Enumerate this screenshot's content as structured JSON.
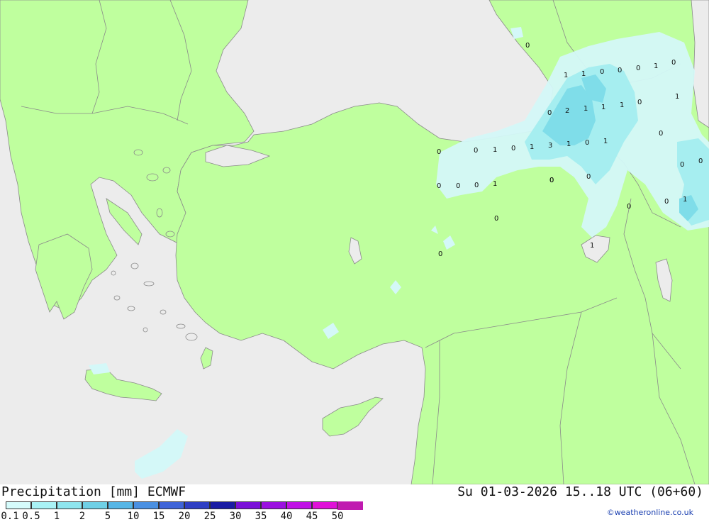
{
  "map": {
    "region": "Eastern Mediterranean / Anatolia",
    "colors": {
      "sea": "#ececec",
      "land": "#bfff9e",
      "border": "#8a8a8a",
      "precip_light": "#d4f8f8",
      "precip_mid": "#a6eef0",
      "precip_heavy": "#7fdde9"
    },
    "labels": [
      {
        "text": "0"
      },
      {
        "text": "1"
      },
      {
        "text": "1"
      },
      {
        "text": "0"
      },
      {
        "text": "0"
      },
      {
        "text": "0"
      },
      {
        "text": "1"
      },
      {
        "text": "0"
      },
      {
        "text": "1"
      },
      {
        "text": "0"
      },
      {
        "text": "2"
      },
      {
        "text": "1"
      },
      {
        "text": "1"
      },
      {
        "text": "1"
      },
      {
        "text": "0"
      },
      {
        "text": "0"
      },
      {
        "text": "0"
      },
      {
        "text": "0"
      },
      {
        "text": "1"
      },
      {
        "text": "0"
      },
      {
        "text": "1"
      },
      {
        "text": "3"
      },
      {
        "text": "1"
      },
      {
        "text": "0"
      },
      {
        "text": "1"
      },
      {
        "text": "0"
      },
      {
        "text": "0"
      },
      {
        "text": "0"
      },
      {
        "text": "0"
      },
      {
        "text": "0"
      },
      {
        "text": "0"
      },
      {
        "text": "1"
      },
      {
        "text": "0"
      },
      {
        "text": "0"
      },
      {
        "text": "0"
      },
      {
        "text": "1"
      },
      {
        "text": "0"
      },
      {
        "text": "0"
      },
      {
        "text": "1"
      },
      {
        "text": "0"
      }
    ]
  },
  "footer": {
    "title": "Precipitation [mm] ECMWF",
    "validity": "Su 01-03-2026 15..18 UTC (06+60)",
    "credit": "©weatheronline.co.uk",
    "legend": {
      "ticks": [
        "0.1",
        "0.5",
        "1",
        "2",
        "5",
        "10",
        "15",
        "20",
        "25",
        "30",
        "35",
        "40",
        "45",
        "50"
      ],
      "colors": [
        "#d5fbfb",
        "#a9f2f5",
        "#8ee5ee",
        "#6fd0e6",
        "#56b6e6",
        "#4a90e2",
        "#3f64d8",
        "#2f3fc4",
        "#1a1ca4",
        "#7a10d8",
        "#9b10e0",
        "#c010e6",
        "#e010d8",
        "#c01ab0"
      ]
    }
  }
}
